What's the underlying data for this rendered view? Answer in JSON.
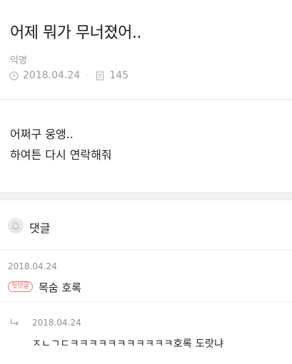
{
  "post": {
    "title": "어제 뭐가 무너졌어..",
    "author": "익명",
    "date": "2018.04.24",
    "separator": "·",
    "views": "145",
    "body_line1": "어쩌구 웅앵..",
    "body_line2": "하여튼 다시 연락해줘"
  },
  "comments_section": {
    "title": "댓글",
    "icon": "bell-icon"
  },
  "comments": [
    {
      "date": "2018.04.24",
      "badge": "첫댓글",
      "text": "목숨 호록"
    }
  ],
  "replies": [
    {
      "icon": "reply-arrow-icon",
      "date": "2018.04.24",
      "text": "ㅈㄴㄱㄷㅋㅋㅋㅋㅋㅋㅋㅋㅋㅋㅋ호록 도랏냐"
    }
  ],
  "colors": {
    "badge": "#f06a6a",
    "muted_text": "#9a9a9a",
    "divider_bar": "#f1f1f1"
  }
}
